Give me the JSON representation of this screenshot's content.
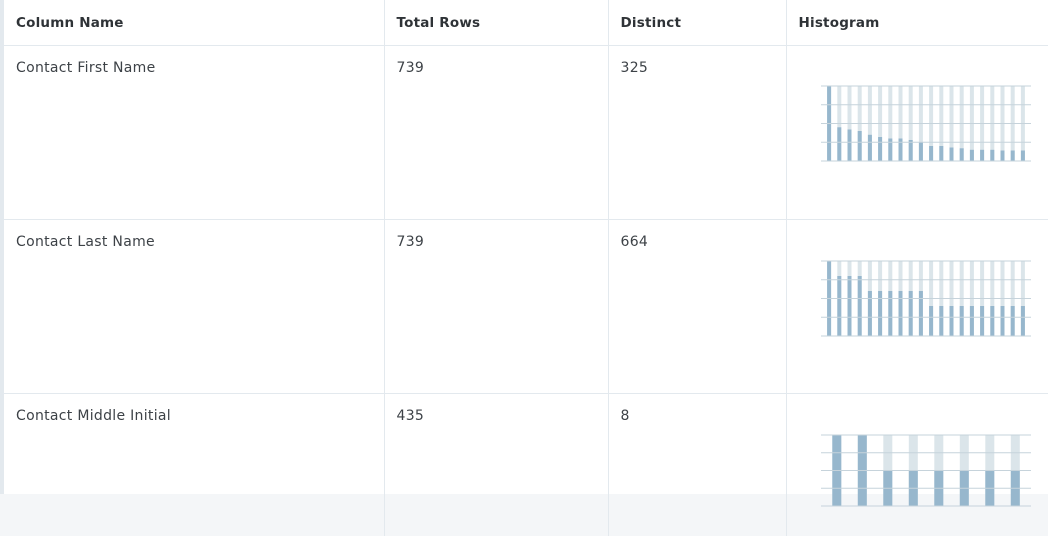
{
  "table": {
    "headers": [
      "Column Name",
      "Total Rows",
      "Distinct",
      "Histogram"
    ],
    "rows": [
      {
        "column_name": "Contact First Name",
        "total_rows": "739",
        "distinct": "325",
        "histogram": [
          1.0,
          0.45,
          0.42,
          0.4,
          0.35,
          0.32,
          0.3,
          0.3,
          0.28,
          0.25,
          0.2,
          0.2,
          0.18,
          0.17,
          0.15,
          0.15,
          0.15,
          0.14,
          0.14,
          0.14
        ]
      },
      {
        "column_name": "Contact Last Name",
        "total_rows": "739",
        "distinct": "664",
        "histogram": [
          1.0,
          0.8,
          0.8,
          0.8,
          0.6,
          0.6,
          0.6,
          0.6,
          0.6,
          0.6,
          0.4,
          0.4,
          0.4,
          0.4,
          0.4,
          0.4,
          0.4,
          0.4,
          0.4,
          0.4
        ]
      },
      {
        "column_name": "Contact Middle Initial",
        "total_rows": "435",
        "distinct": "8",
        "histogram": [
          1.0,
          1.0,
          0.5,
          0.5,
          0.5,
          0.5,
          0.5,
          0.5
        ]
      }
    ]
  },
  "colors": {
    "bar": "#97b7cd",
    "bar_background": "#dbe5ea",
    "gridline": "#c6d3db",
    "border": "#e3e9ee"
  }
}
